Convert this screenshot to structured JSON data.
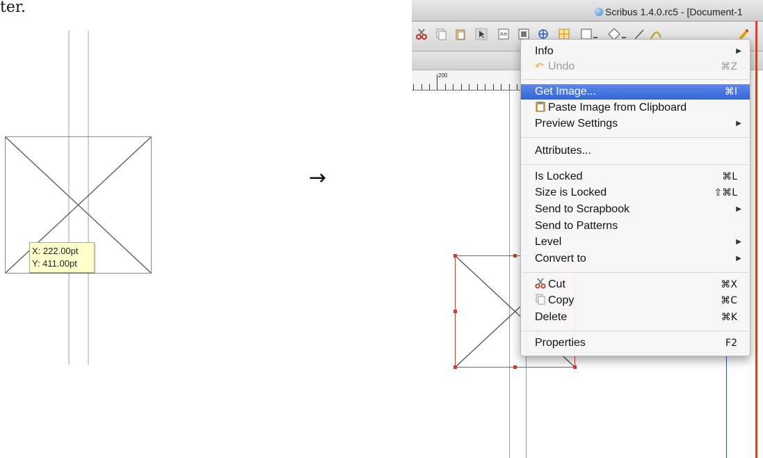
{
  "left_panel": {
    "page_text_fragment": "ter.",
    "tooltip": {
      "x_label": "X: 222.00pt",
      "y_label": "Y: 411.00pt"
    },
    "arrow": "→"
  },
  "window": {
    "title": "Scribus 1.4.0.rc5 - [Document-1",
    "ruler_label": "200",
    "icons": [
      "scissors-icon",
      "copy-icon",
      "paste-icon",
      "select-icon",
      "text-frame-icon",
      "image-frame-icon",
      "render-frame-icon",
      "table-icon",
      "shape-icon",
      "polygon-icon",
      "line-icon",
      "bezier-icon",
      "pencil-icon"
    ]
  },
  "context_menu": {
    "items": [
      {
        "label": "Info",
        "submenu": true
      },
      {
        "label": "Undo",
        "shortcut": "⌘Z",
        "disabled": true,
        "icon": "undo-icon"
      },
      {
        "label": "Get Image...",
        "shortcut": "⌘I",
        "highlighted": true
      },
      {
        "label": "Paste Image from Clipboard",
        "icon": "clipboard-icon"
      },
      {
        "label": "Preview Settings",
        "submenu": true
      },
      {
        "label": "Attributes..."
      },
      {
        "label": "Is Locked",
        "shortcut": "⌘L"
      },
      {
        "label": "Size is Locked",
        "shortcut": "⇧⌘L"
      },
      {
        "label": "Send to Scrapbook",
        "submenu": true
      },
      {
        "label": "Send to Patterns"
      },
      {
        "label": "Level",
        "submenu": true
      },
      {
        "label": "Convert to",
        "submenu": true
      },
      {
        "label": "Cut",
        "shortcut": "⌘X",
        "icon": "scissors-icon"
      },
      {
        "label": "Copy",
        "shortcut": "⌘C",
        "icon": "copy-icon"
      },
      {
        "label": "Delete",
        "shortcut": "⌘K"
      },
      {
        "label": "Properties",
        "shortcut": "F2"
      }
    ],
    "submenu_glyph": "▶"
  },
  "colors": {
    "highlight": "#3b6ddb",
    "selection": "#d03a2a",
    "guide": "#cfcfcf",
    "tooltip_bg": "#ffffcc"
  }
}
